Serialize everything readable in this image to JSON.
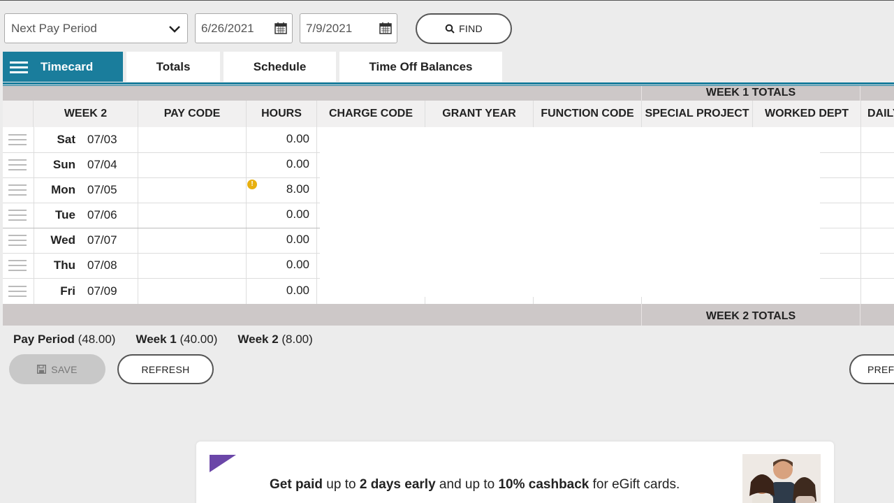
{
  "filters": {
    "period_select": "Next Pay Period",
    "start_date": "6/26/2021",
    "end_date": "7/9/2021",
    "find_label": "FIND"
  },
  "tabs": [
    {
      "label": "Timecard",
      "active": true
    },
    {
      "label": "Totals"
    },
    {
      "label": "Schedule"
    },
    {
      "label": "Time Off Balances"
    }
  ],
  "grid": {
    "week1_totals_label": "WEEK 1 TOTALS",
    "week2_totals_label": "WEEK 2 TOTALS",
    "columns": [
      "WEEK 2",
      "PAY CODE",
      "HOURS",
      "CHARGE CODE",
      "GRANT YEAR",
      "FUNCTION CODE",
      "SPECIAL PROJECT",
      "WORKED DEPT",
      "DAILY"
    ],
    "rows": [
      {
        "day": "Sat",
        "date": "07/03",
        "hours": "0.00"
      },
      {
        "day": "Sun",
        "date": "07/04",
        "hours": "0.00"
      },
      {
        "day": "Mon",
        "date": "07/05",
        "hours": "8.00",
        "warning": true
      },
      {
        "day": "Tue",
        "date": "07/06",
        "hours": "0.00"
      },
      {
        "day": "Wed",
        "date": "07/07",
        "hours": "0.00"
      },
      {
        "day": "Thu",
        "date": "07/08",
        "hours": "0.00"
      },
      {
        "day": "Fri",
        "date": "07/09",
        "hours": "0.00"
      }
    ]
  },
  "totals": {
    "pay_period_label": "Pay Period",
    "pay_period_value": "(48.00)",
    "week1_label": "Week 1",
    "week1_value": "(40.00)",
    "week2_label": "Week 2",
    "week2_value": "(8.00)"
  },
  "buttons": {
    "save": "SAVE",
    "refresh": "REFRESH",
    "preferences": "PREFE"
  },
  "promo": {
    "p1": "Get paid",
    "p2": " up to ",
    "p3": "2 days early",
    "p4": " and up to ",
    "p5": "10% cashback",
    "p6": " for eGift cards."
  },
  "colors": {
    "accent": "#1a7d9c",
    "band": "#cdc8c8",
    "promo_accent": "#6b46a8"
  }
}
